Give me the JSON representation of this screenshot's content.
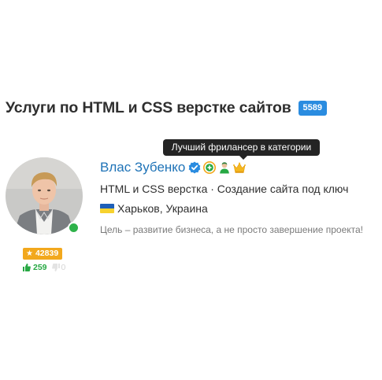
{
  "category": {
    "title": "Услуги по HTML и CSS верстке сайтов",
    "count": "5589"
  },
  "tooltip": {
    "text": "Лучший фрилансер в категории"
  },
  "freelancer": {
    "name": "Влас Зубенко",
    "icons": [
      "verified-check-icon",
      "plus-badge-icon",
      "person-badge-icon",
      "crown-icon"
    ],
    "specializations": "HTML и CSS верстка · Создание сайта под ключ",
    "location": "Харьков, Украина",
    "slogan": "Цель – развитие бизнеса, а не просто завершение проекта!",
    "online": true,
    "rating": "42839",
    "likes": "259",
    "dislikes": "0"
  },
  "colors": {
    "link": "#1f73b7",
    "badge_blue": "#2a8ce0",
    "rating_orange": "#f2a81d",
    "positive_green": "#27a843",
    "online_green": "#2eb24a",
    "tooltip_bg": "#242424"
  }
}
